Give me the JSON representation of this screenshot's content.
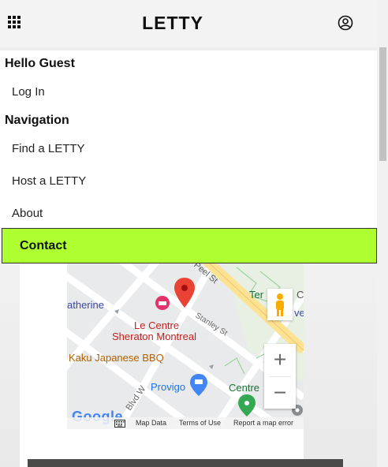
{
  "header": {
    "brand": "LETTY",
    "menu_icon": "grid-menu-icon",
    "account_icon": "account-circle-icon"
  },
  "menu": {
    "greeting": "Hello Guest",
    "login": "Log In",
    "nav_heading": "Navigation",
    "items": [
      {
        "label": "Find a LETTY"
      },
      {
        "label": "Host a LETTY"
      },
      {
        "label": "About"
      }
    ],
    "active_item": "Contact"
  },
  "map": {
    "labels": {
      "peel": "Peel St",
      "catherine": "atherine",
      "hotel_1": "Le Centre",
      "hotel_2": "Sheraton Montreal",
      "stanley": "Stanley St",
      "restaurant": "Kaku Japanese BBQ",
      "provigo": "Provigo",
      "centre": "Centre",
      "ter": "Ter",
      "blvd": "Blvd W",
      "edge_c": "C",
      "edge_e": "ve",
      "logo": "Google"
    },
    "footer": {
      "map_data": "Map Data",
      "terms": "Terms of Use",
      "report": "Report a map error"
    },
    "controls": {
      "zoom_in": "+",
      "zoom_out": "−"
    }
  },
  "colors": {
    "accent": "#adff2f",
    "marker": "#ea4335",
    "hotel": "#e2336b",
    "restaurant": "#e8711c",
    "shop": "#4285f4",
    "park": "#34a853",
    "road_major": "#fde293"
  }
}
